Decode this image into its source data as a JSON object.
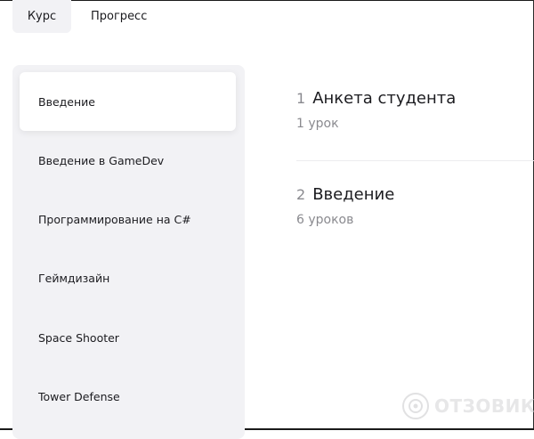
{
  "tabs": [
    {
      "label": "Курс",
      "active": true
    },
    {
      "label": "Прогресс",
      "active": false
    }
  ],
  "sidebar": {
    "items": [
      {
        "label": "Введение",
        "active": true
      },
      {
        "label": "Введение в GameDev",
        "active": false
      },
      {
        "label": "Программирование на C#",
        "active": false
      },
      {
        "label": "Геймдизайн",
        "active": false
      },
      {
        "label": "Space Shooter",
        "active": false
      },
      {
        "label": "Tower Defense",
        "active": false
      }
    ]
  },
  "modules": [
    {
      "number": "1",
      "title": "Анкета студента",
      "subtitle": "1 урок"
    },
    {
      "number": "2",
      "title": "Введение",
      "subtitle": "6 уроков"
    }
  ],
  "watermark": {
    "text": "ОТЗОВИК"
  },
  "colors": {
    "sidebar_bg": "#f2f2f5",
    "muted_text": "#8a8a8f",
    "main_text": "#1b1b1f"
  }
}
